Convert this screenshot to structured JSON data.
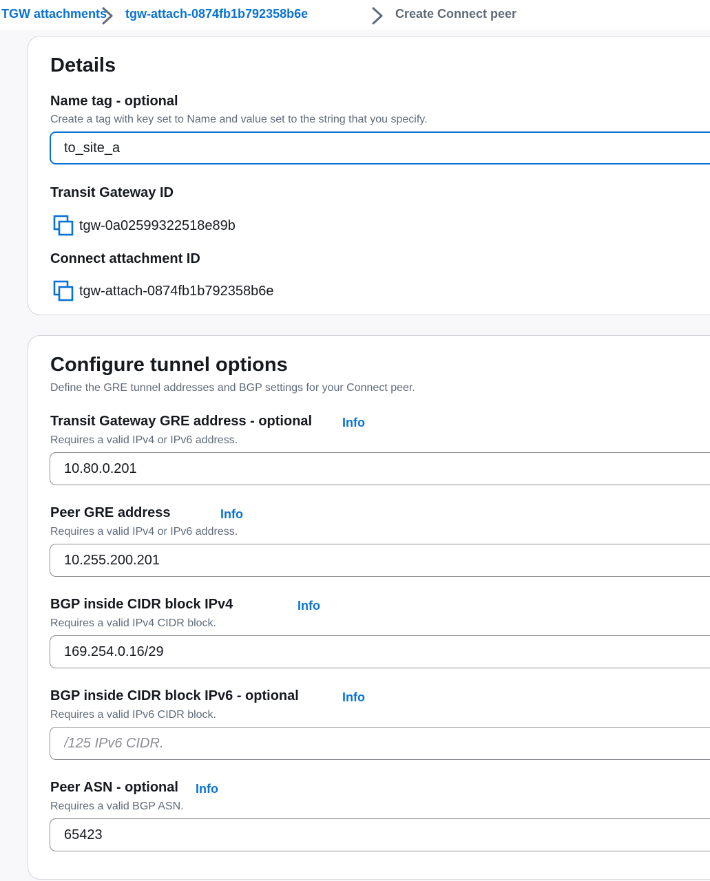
{
  "breadcrumb": {
    "items": [
      {
        "label": "TGW attachments"
      },
      {
        "label": "tgw-attach-0874fb1b792358b6e"
      },
      {
        "label": "Create Connect peer"
      }
    ]
  },
  "details": {
    "title": "Details",
    "name_tag": {
      "label": "Name tag - optional",
      "description": "Create a tag with key set to Name and value set to the string that you specify.",
      "value": "to_site_a"
    },
    "transit_gateway": {
      "label": "Transit Gateway ID",
      "value": "tgw-0a02599322518e89b"
    },
    "connect_attachment": {
      "label": "Connect attachment ID",
      "value": "tgw-attach-0874fb1b792358b6e"
    }
  },
  "tunnel": {
    "title": "Configure tunnel options",
    "description": "Define the GRE tunnel addresses and BGP settings for your Connect peer.",
    "info_label": "Info",
    "fields": [
      {
        "label": "Transit Gateway GRE address - optional",
        "hint": "Requires a valid IPv4 or IPv6 address.",
        "value": "10.80.0.201",
        "placeholder": ""
      },
      {
        "label": "Peer GRE address",
        "hint": "Requires a valid IPv4 or IPv6 address.",
        "value": "10.255.200.201",
        "placeholder": ""
      },
      {
        "label": "BGP inside CIDR block IPv4",
        "hint": "Requires a valid IPv4 CIDR block.",
        "value": "169.254.0.16/29",
        "placeholder": ""
      },
      {
        "label": "BGP inside CIDR block IPv6 - optional",
        "hint": "Requires a valid IPv6 CIDR block.",
        "value": "",
        "placeholder": "/125 IPv6 CIDR."
      },
      {
        "label": "Peer ASN - optional",
        "hint": "Requires a valid BGP ASN.",
        "value": "65423",
        "placeholder": ""
      }
    ]
  },
  "colors": {
    "link": "#0972d3",
    "text": "#16191f",
    "muted": "#5f6b7a",
    "focus": "#0972d3"
  },
  "icons": {
    "breadcrumb_separator": "chevron-right-icon",
    "copy": "copy-icon"
  }
}
